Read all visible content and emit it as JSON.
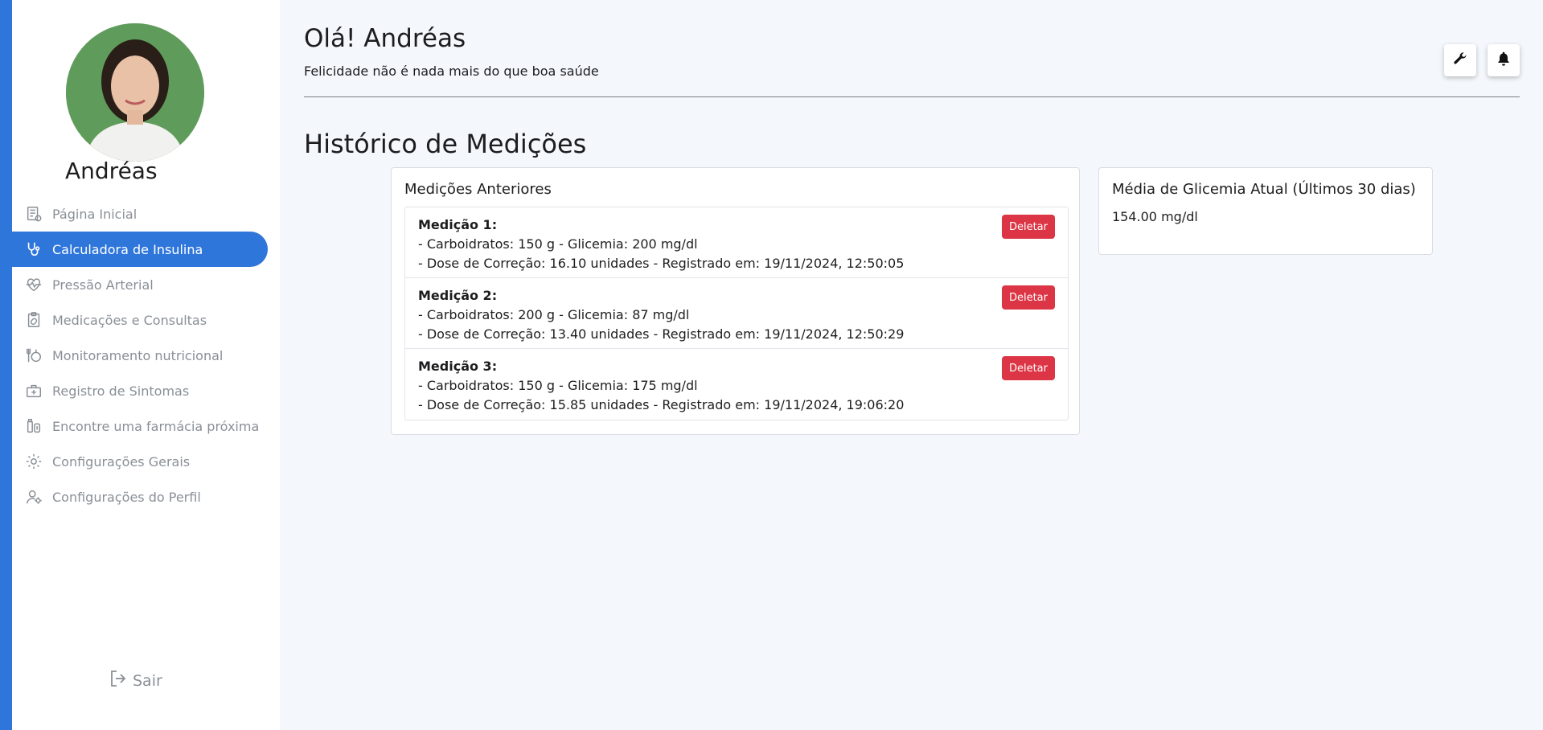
{
  "user": {
    "name": "Andréas"
  },
  "sidebar": {
    "items": [
      {
        "label": "Página Inicial",
        "icon": "home-list-icon",
        "active": false
      },
      {
        "label": "Calculadora de Insulina",
        "icon": "stethoscope-icon",
        "active": true
      },
      {
        "label": "Pressão Arterial",
        "icon": "heart-pulse-icon",
        "active": false
      },
      {
        "label": "Medicações e Consultas",
        "icon": "clipboard-pill-icon",
        "active": false
      },
      {
        "label": "Monitoramento nutricional",
        "icon": "nutrition-icon",
        "active": false
      },
      {
        "label": "Registro de Sintomas",
        "icon": "medical-bag-icon",
        "active": false
      },
      {
        "label": "Encontre uma farmácia próxima",
        "icon": "pharmacy-icon",
        "active": false
      },
      {
        "label": "Configurações Gerais",
        "icon": "gear-icon",
        "active": false
      },
      {
        "label": "Configurações do Perfil",
        "icon": "user-gear-icon",
        "active": false
      }
    ],
    "logout_label": "Sair"
  },
  "header": {
    "greeting": "Olá! Andréas",
    "tagline": "Felicidade não é nada mais do que boa saúde"
  },
  "page": {
    "title": "Histórico de Medições"
  },
  "history": {
    "title": "Medições Anteriores",
    "delete_label": "Deletar",
    "items": [
      {
        "title": "Medição 1:",
        "line1": "- Carboidratos: 150 g - Glicemia: 200 mg/dl",
        "line2": "- Dose de Correção: 16.10 unidades - Registrado em: 19/11/2024, 12:50:05"
      },
      {
        "title": "Medição 2:",
        "line1": "- Carboidratos: 200 g - Glicemia: 87 mg/dl",
        "line2": "- Dose de Correção: 13.40 unidades - Registrado em: 19/11/2024, 12:50:29"
      },
      {
        "title": "Medição 3:",
        "line1": "- Carboidratos: 150 g - Glicemia: 175 mg/dl",
        "line2": "- Dose de Correção: 15.85 unidades - Registrado em: 19/11/2024, 19:06:20"
      }
    ]
  },
  "average": {
    "title": "Média de Glicemia Atual (Últimos 30 dias)",
    "value": "154.00 mg/dl"
  },
  "colors": {
    "accent": "#2f76db",
    "danger": "#dc3545",
    "background": "#f4f8fc"
  }
}
